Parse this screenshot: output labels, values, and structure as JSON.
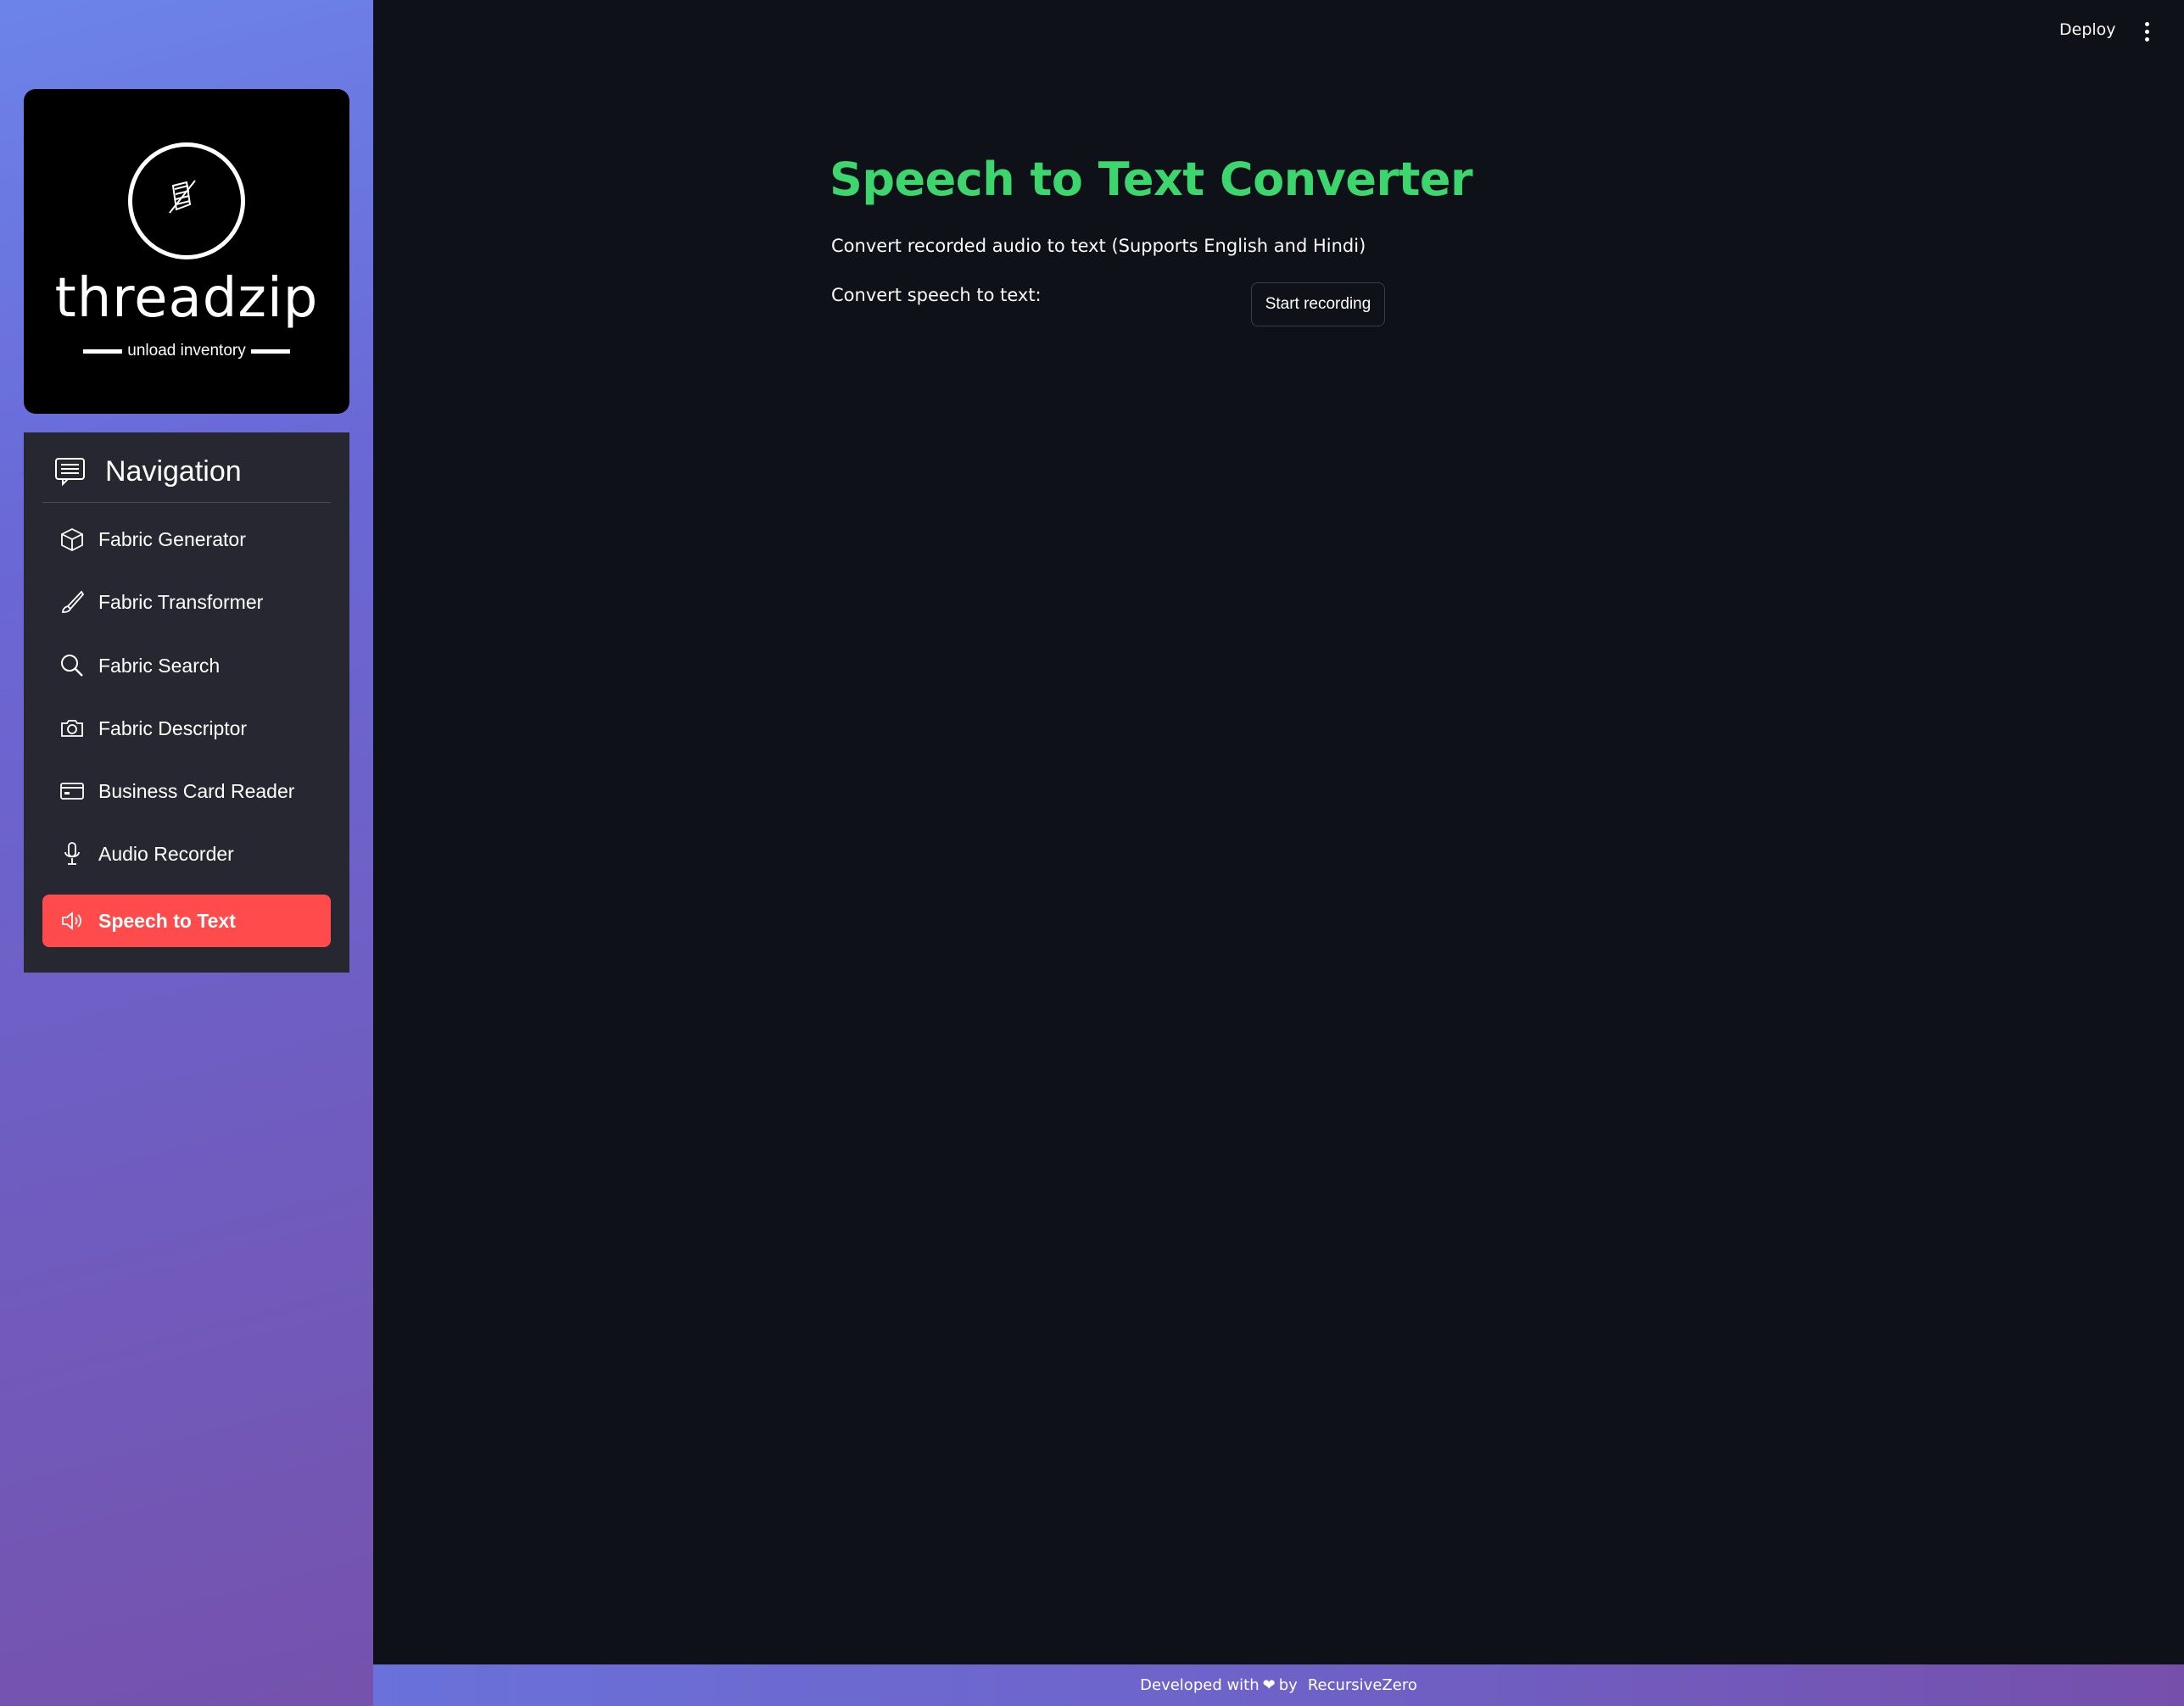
{
  "header": {
    "deploy_label": "Deploy",
    "menu_icon": "more-vertical-icon"
  },
  "sidebar": {
    "logo": {
      "name": "threadzip",
      "tagline": "unload inventory",
      "icon": "needle-thread-icon"
    },
    "nav": {
      "title": "Navigation",
      "title_icon": "list-box-icon",
      "items": [
        {
          "label": "Fabric Generator",
          "icon": "box-icon",
          "active": false
        },
        {
          "label": "Fabric Transformer",
          "icon": "brush-icon",
          "active": false
        },
        {
          "label": "Fabric Search",
          "icon": "search-icon",
          "active": false
        },
        {
          "label": "Fabric Descriptor",
          "icon": "camera-icon",
          "active": false
        },
        {
          "label": "Business Card Reader",
          "icon": "card-icon",
          "active": false
        },
        {
          "label": "Audio Recorder",
          "icon": "microphone-icon",
          "active": false
        },
        {
          "label": "Speech to Text",
          "icon": "speaker-icon",
          "active": true
        }
      ]
    }
  },
  "main": {
    "title": "Speech to Text Converter",
    "subtitle": "Convert recorded audio to text (Supports English and Hindi)",
    "convert_label": "Convert speech to text:",
    "record_button": "Start recording"
  },
  "footer": {
    "prefix": "Developed with",
    "heart": "❤",
    "by": "by",
    "brand": "RecursiveZero"
  },
  "colors": {
    "title": "#3dd56d",
    "active_nav": "#ff4b4b",
    "background": "#0e1117",
    "nav_panel": "#262730"
  }
}
